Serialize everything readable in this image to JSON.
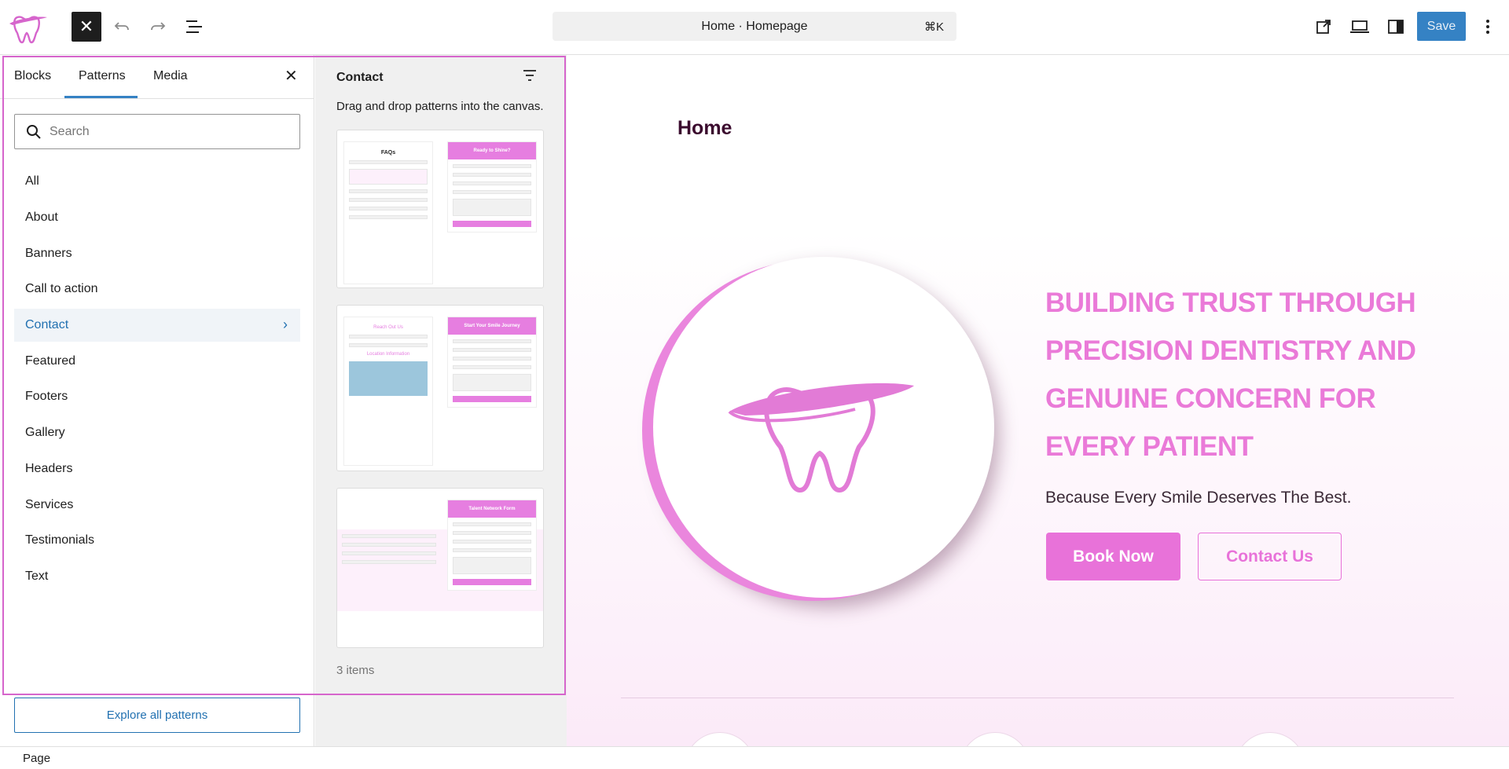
{
  "topbar": {
    "logo_icon": "tooth-logo-icon",
    "close_icon": "close-icon",
    "undo_icon": "undo-icon",
    "redo_icon": "redo-icon",
    "list_view_icon": "list-view-icon",
    "command": {
      "label": "Home · Homepage",
      "shortcut": "⌘K"
    },
    "view_icon": "external-link-icon",
    "device_icon": "laptop-icon",
    "settings_icon": "sidebar-toggle-icon",
    "save_label": "Save",
    "options_icon": "kebab-menu-icon"
  },
  "inserter": {
    "tabs": [
      {
        "label": "Blocks"
      },
      {
        "label": "Patterns"
      },
      {
        "label": "Media"
      }
    ],
    "active_tab": "Patterns",
    "search": {
      "placeholder": "Search",
      "value": ""
    },
    "categories": [
      {
        "label": "All"
      },
      {
        "label": "About"
      },
      {
        "label": "Banners"
      },
      {
        "label": "Call to action"
      },
      {
        "label": "Contact"
      },
      {
        "label": "Featured"
      },
      {
        "label": "Footers"
      },
      {
        "label": "Gallery"
      },
      {
        "label": "Headers"
      },
      {
        "label": "Services"
      },
      {
        "label": "Testimonials"
      },
      {
        "label": "Text"
      }
    ],
    "active_category": "Contact",
    "explore_label": "Explore all patterns"
  },
  "patterns_panel": {
    "title": "Contact",
    "hint": "Drag and drop patterns into the canvas.",
    "cards": [
      {
        "left_heading": "FAQs",
        "form_heading": "Ready to Shine?"
      },
      {
        "left_heading": "Reach Out Us",
        "left_subheading": "Location Information",
        "form_heading": "Start Your Smile Journey"
      },
      {
        "form_heading": "Talent Network Form"
      }
    ],
    "count_label": "3 items"
  },
  "canvas": {
    "page_title": "Home",
    "hero_title": "BUILDING TRUST THROUGH PRECISION DENTISTRY AND GENUINE CONCERN FOR EVERY PATIENT",
    "hero_subtitle": "Because Every Smile Deserves The Best.",
    "primary_button": "Book Now",
    "secondary_button": "Contact Us",
    "hero_icon": "tooth-icon"
  },
  "statusbar": {
    "breadcrumb": "Page"
  },
  "colors": {
    "accent": "#e872d9",
    "wp_blue": "#3582c4",
    "selection": "#d665cc"
  }
}
